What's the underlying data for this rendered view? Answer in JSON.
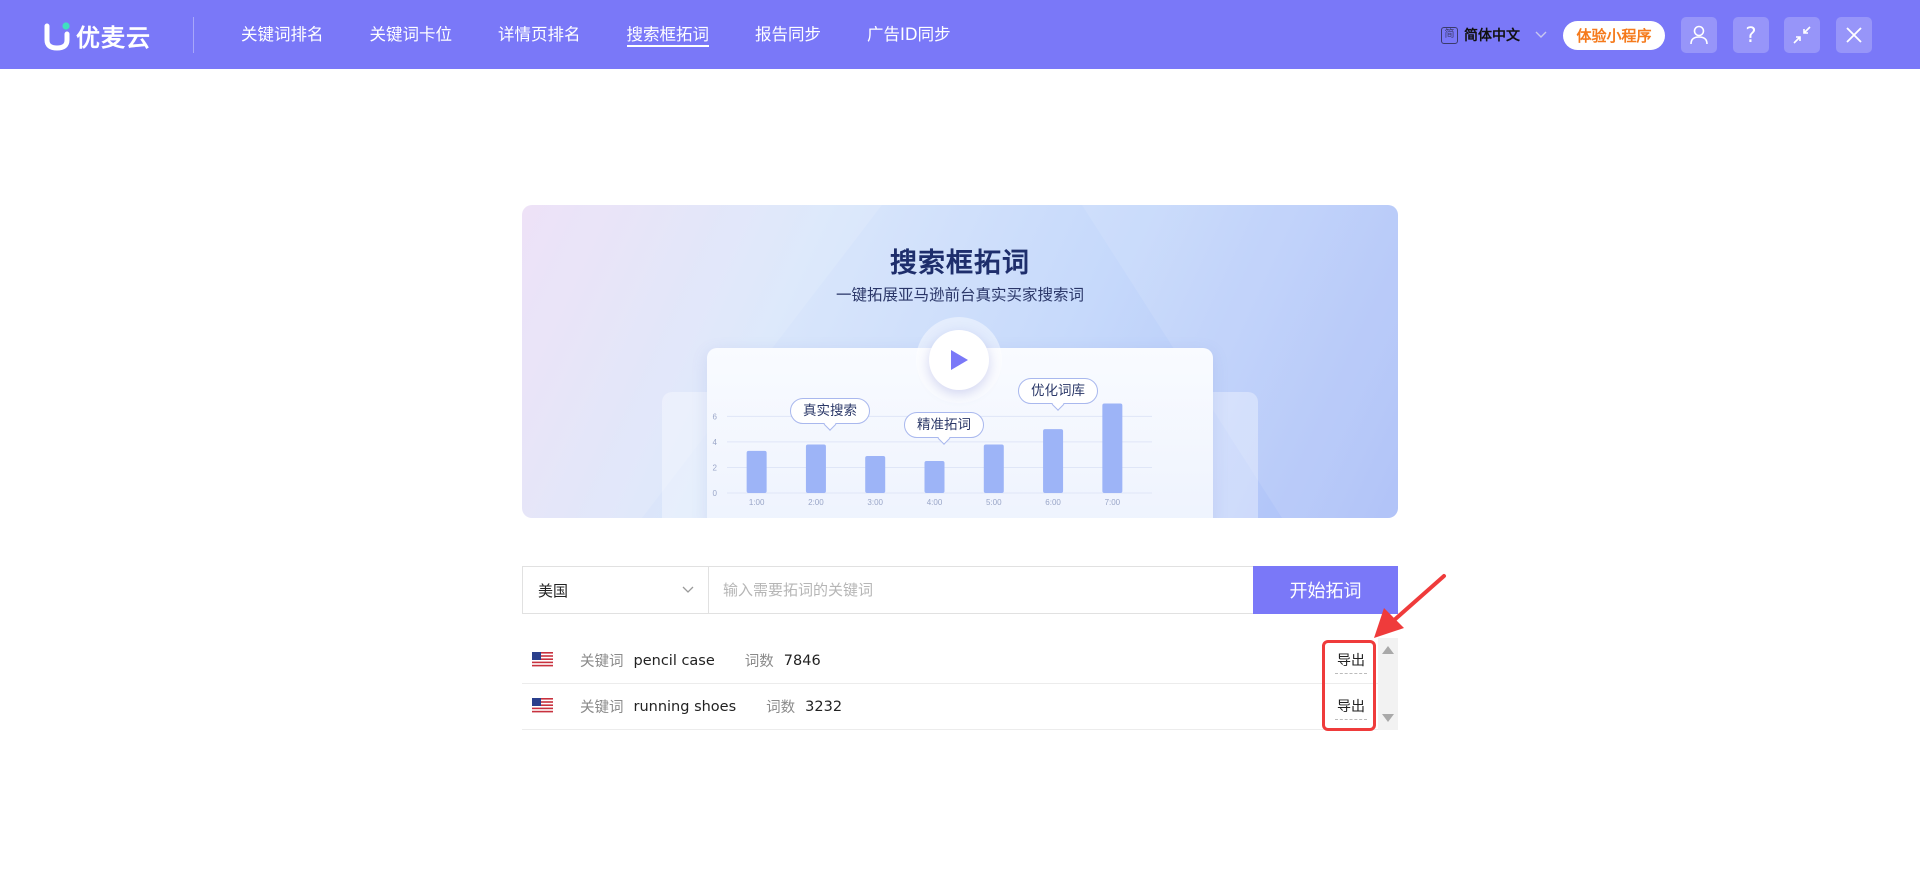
{
  "brand": {
    "logo_text": "优麦云",
    "accent_color": "#7a78f8"
  },
  "nav": {
    "items": [
      {
        "label": "关键词排名"
      },
      {
        "label": "关键词卡位"
      },
      {
        "label": "详情页排名"
      },
      {
        "label": "搜索框拓词",
        "active": true
      },
      {
        "label": "报告同步"
      },
      {
        "label": "广告ID同步"
      }
    ]
  },
  "header_right": {
    "lang_icon_char": "简",
    "language": "简体中文",
    "mini_program": "体验小程序",
    "icons": [
      "user-icon",
      "help-icon",
      "collapse-icon",
      "close-icon"
    ],
    "help_glyph": "?"
  },
  "banner": {
    "title": "搜索框拓词",
    "subtitle": "一键拓展亚马逊前台真实买家搜索词",
    "tags": [
      "真实搜索",
      "精准拓词",
      "优化词库"
    ]
  },
  "chart_data": {
    "type": "bar",
    "categories": [
      "1:00",
      "2:00",
      "3:00",
      "4:00",
      "5:00",
      "6:00",
      "7:00"
    ],
    "values": [
      3.3,
      3.8,
      2.9,
      2.5,
      3.8,
      5.0,
      7.0
    ],
    "y_ticks": [
      0,
      2,
      4,
      6
    ],
    "ylim": [
      0,
      7.2
    ],
    "title": "",
    "xlabel": "",
    "ylabel": "",
    "bar_color": "#9db4f7"
  },
  "search": {
    "country": "美国",
    "placeholder": "输入需要拓词的关键词",
    "value": "",
    "submit_label": "开始拓词"
  },
  "results": [
    {
      "keyword_label": "关键词",
      "keyword": "pencil case",
      "count_label": "词数",
      "count": "7846",
      "export_label": "导出"
    },
    {
      "keyword_label": "关键词",
      "keyword": "running shoes",
      "count_label": "词数",
      "count": "3232",
      "export_label": "导出"
    }
  ],
  "annotation_color": "#ef3b3b"
}
